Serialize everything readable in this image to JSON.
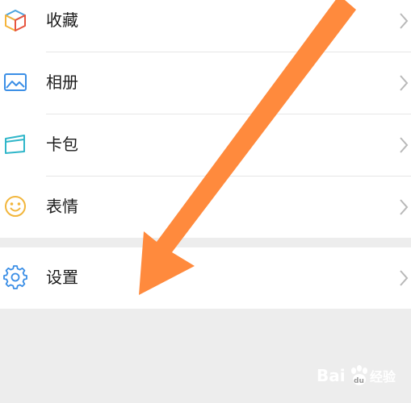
{
  "menu": {
    "items": [
      {
        "label": "收藏",
        "icon": "favorites-cube-icon"
      },
      {
        "label": "相册",
        "icon": "album-picture-icon"
      },
      {
        "label": "卡包",
        "icon": "card-wallet-icon"
      },
      {
        "label": "表情",
        "icon": "sticker-smiley-icon"
      }
    ],
    "settings": {
      "label": "设置",
      "icon": "gear-icon"
    }
  },
  "annotation": {
    "arrow_color": "#ff8a3d"
  },
  "watermark": {
    "text": "Bai",
    "paw": "du",
    "suffix": "经验"
  },
  "colors": {
    "background": "#ededed",
    "row": "#ffffff",
    "icon_blue": "#3a8ee6",
    "chevron": "#b8b8b8"
  }
}
